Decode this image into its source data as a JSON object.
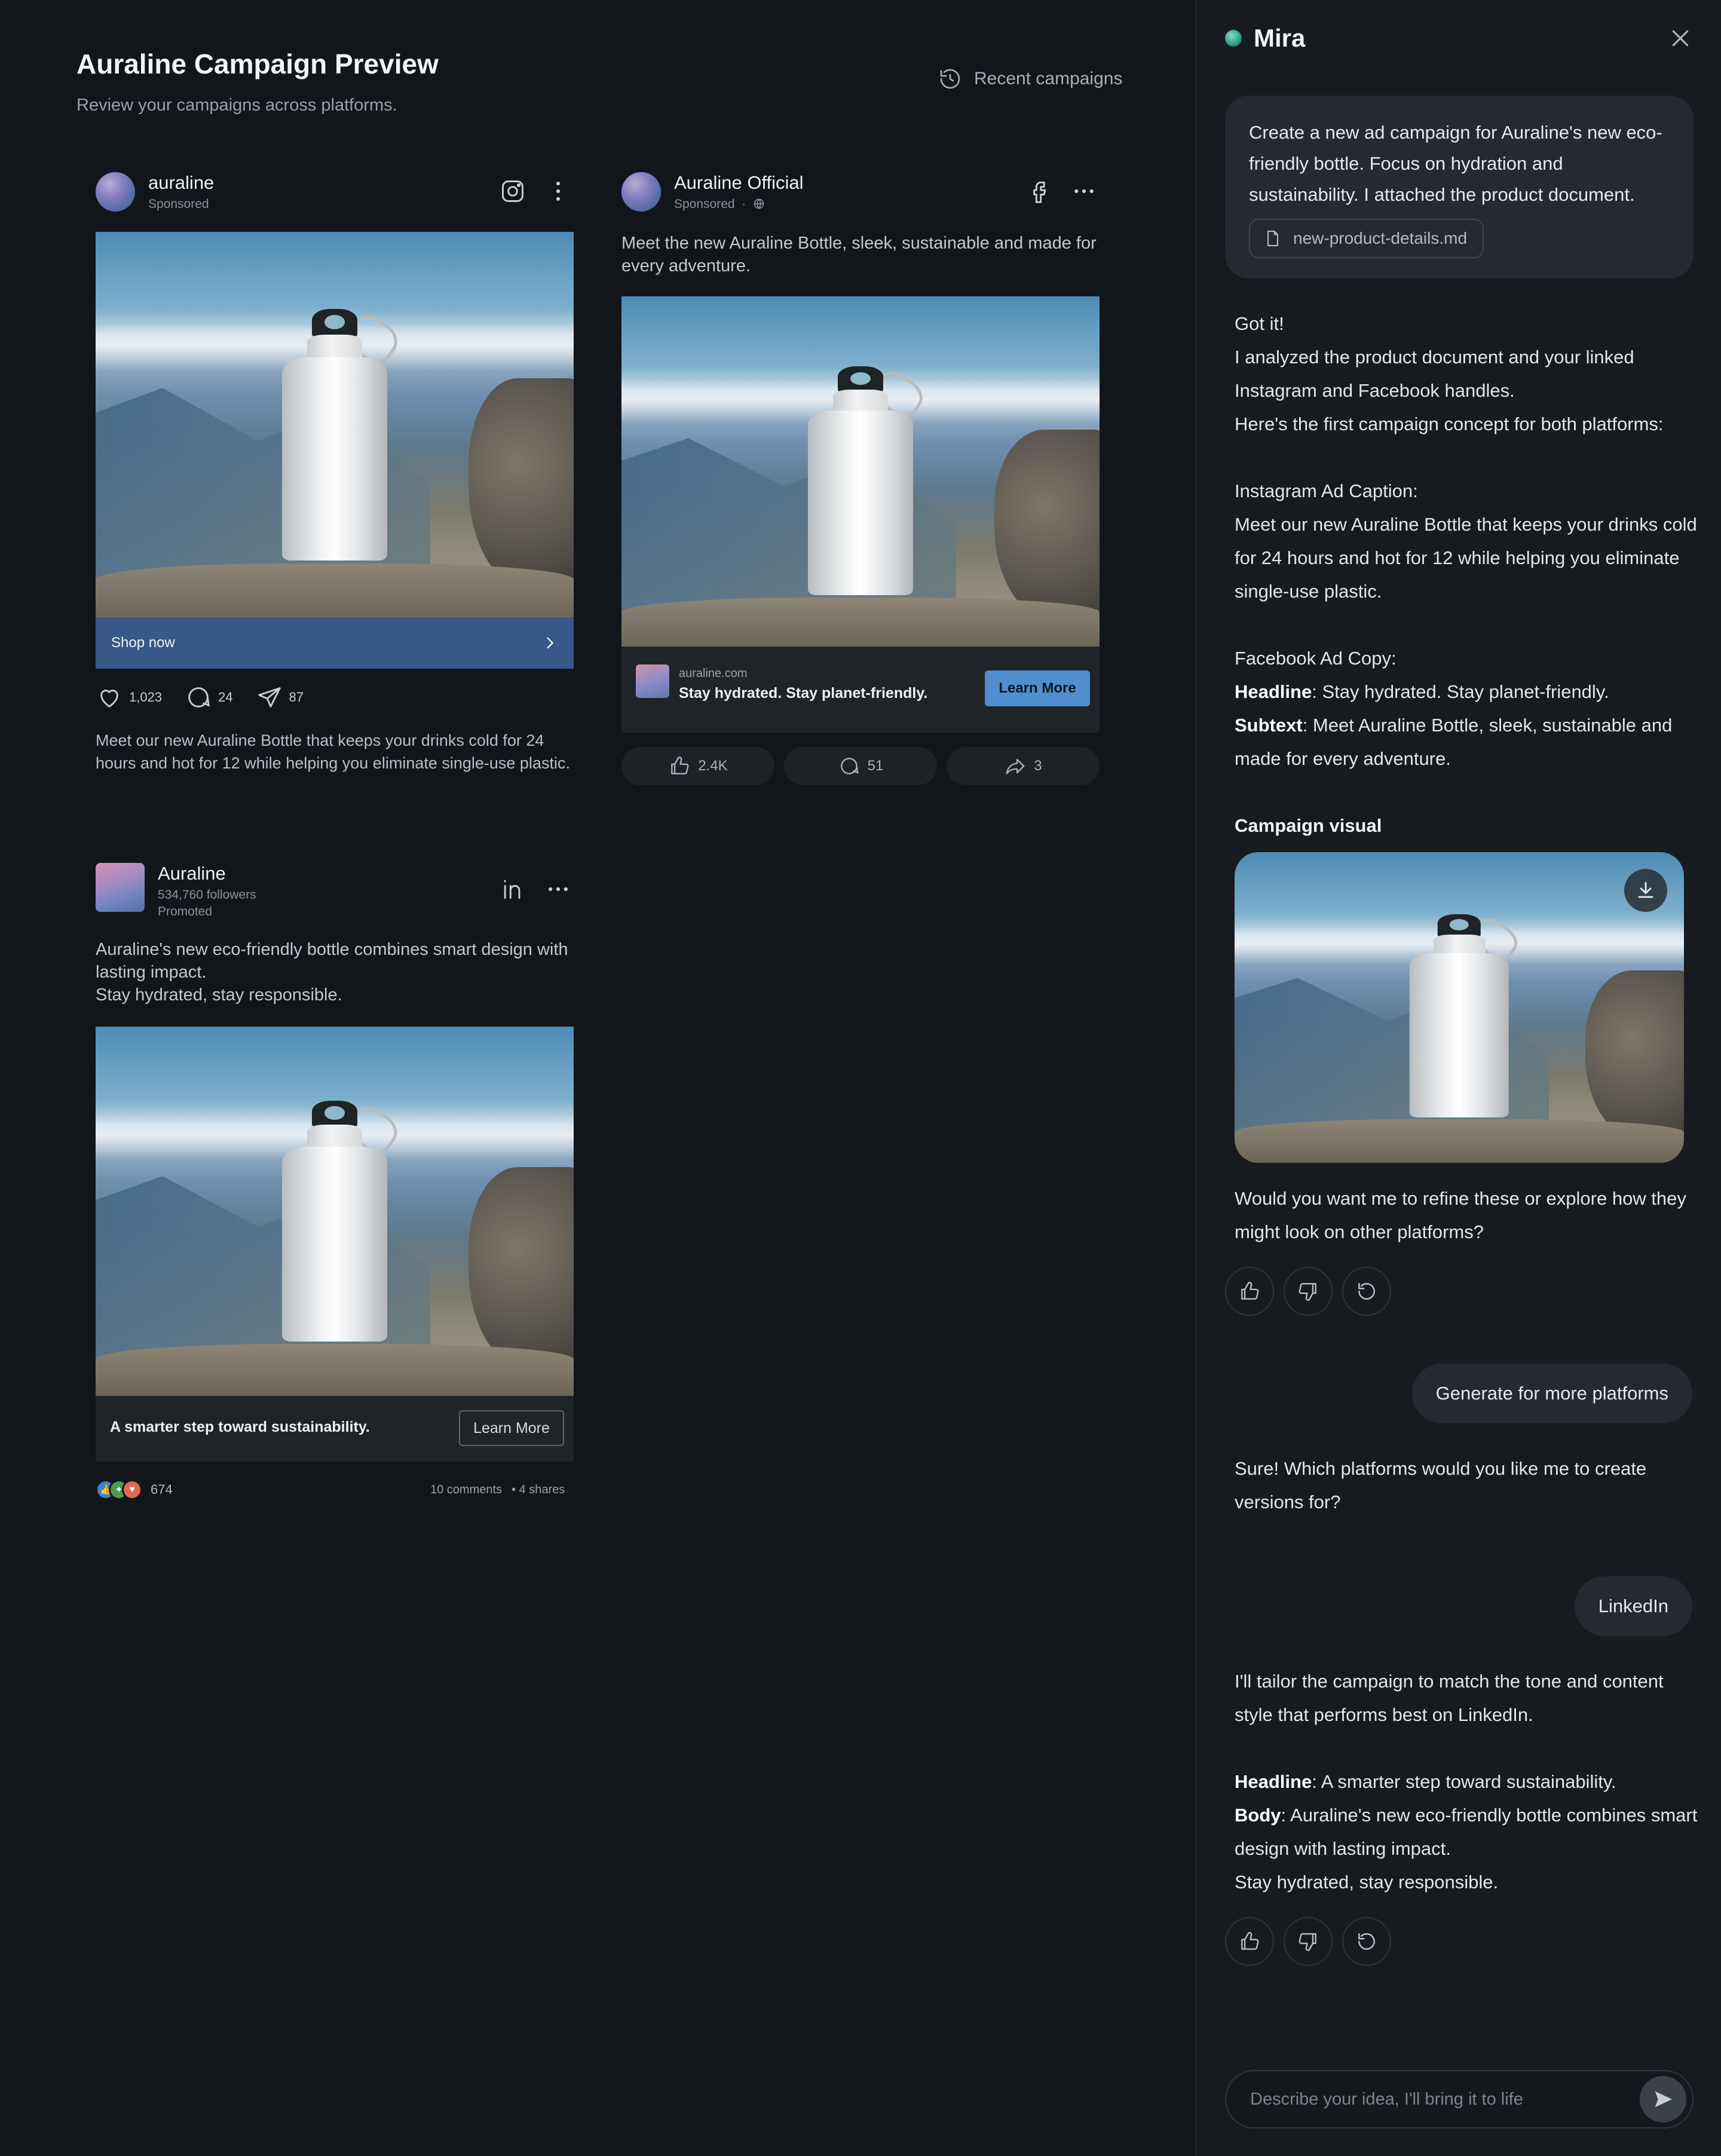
{
  "preview": {
    "title": "Auraline Campaign Preview",
    "subtitle": "Review your campaigns across platforms.",
    "recent_label": "Recent campaigns"
  },
  "instagram": {
    "account": "auraline",
    "sponsored": "Sponsored",
    "cta": "Shop now",
    "likes": "1,023",
    "comments": "24",
    "shares": "87",
    "caption": "Meet our new Auraline Bottle that keeps your drinks cold for 24 hours and hot for 12 while helping you eliminate single-use plastic."
  },
  "facebook": {
    "account": "Auraline Official",
    "sponsored": "Sponsored",
    "dot": "·",
    "caption": "Meet the new Auraline Bottle, sleek, sustainable and made for every adventure.",
    "domain": "auraline.com",
    "headline": "Stay hydrated. Stay planet-friendly.",
    "cta": "Learn More",
    "likes": "2.4K",
    "comments": "51",
    "shares": "3"
  },
  "linkedin": {
    "account": "Auraline",
    "followers": "534,760 followers",
    "promoted": "Promoted",
    "caption_line1": "Auraline's new eco-friendly bottle combines smart design with lasting impact.",
    "caption_line2": "Stay hydrated, stay responsible.",
    "cta_text": "A smarter step toward sustainability.",
    "cta": "Learn More",
    "reactions": "674",
    "comments": "10 comments",
    "shares": "• 4 shares"
  },
  "chat": {
    "title": "Mira",
    "user_msg_1": "Create a new ad campaign for Auraline's new eco-friendly bottle. Focus on hydration and sustainability. I attached the product document.",
    "attachment": "new-product-details.md",
    "reply_1": {
      "l1": "Got it!",
      "l2": "I analyzed the product document and your linked Instagram and Facebook handles.",
      "l3": "Here's the first campaign concept for both platforms:",
      "ig_label": "Instagram Ad Caption:",
      "ig_text": "Meet our new Auraline Bottle that keeps your drinks cold for 24 hours and hot for 12 while helping you eliminate single-use plastic.",
      "fb_label": "Facebook Ad Copy:",
      "headline_key": "Headline",
      "headline_val": ": Stay hydrated. Stay planet-friendly.",
      "subtext_key": "Subtext",
      "subtext_val": ": Meet Auraline Bottle, sleek, sustainable and made for every adventure."
    },
    "visual_heading": "Campaign visual",
    "refine_q": "Would you want me to refine these or explore how they might look on other platforms?",
    "user_msg_2": "Generate for more platforms",
    "reply_2": "Sure! Which platforms would you like me to create versions for?",
    "user_msg_3": "LinkedIn",
    "reply_3": {
      "intro": "I'll tailor the campaign to match the tone and content style that performs best on LinkedIn.",
      "headline_key": "Headline",
      "headline_val": ": A smarter step toward sustainability.",
      "body_key": "Body",
      "body_val": ": Auraline's new eco-friendly bottle combines smart design with lasting impact.",
      "body_line2": " Stay hydrated, stay responsible."
    },
    "composer_placeholder": "Describe your idea, I'll bring it to life"
  },
  "colors": {
    "background": "#12161b",
    "panel": "#171b20",
    "instagram_cta": "#375889",
    "facebook_cta": "#4f8fd0"
  }
}
